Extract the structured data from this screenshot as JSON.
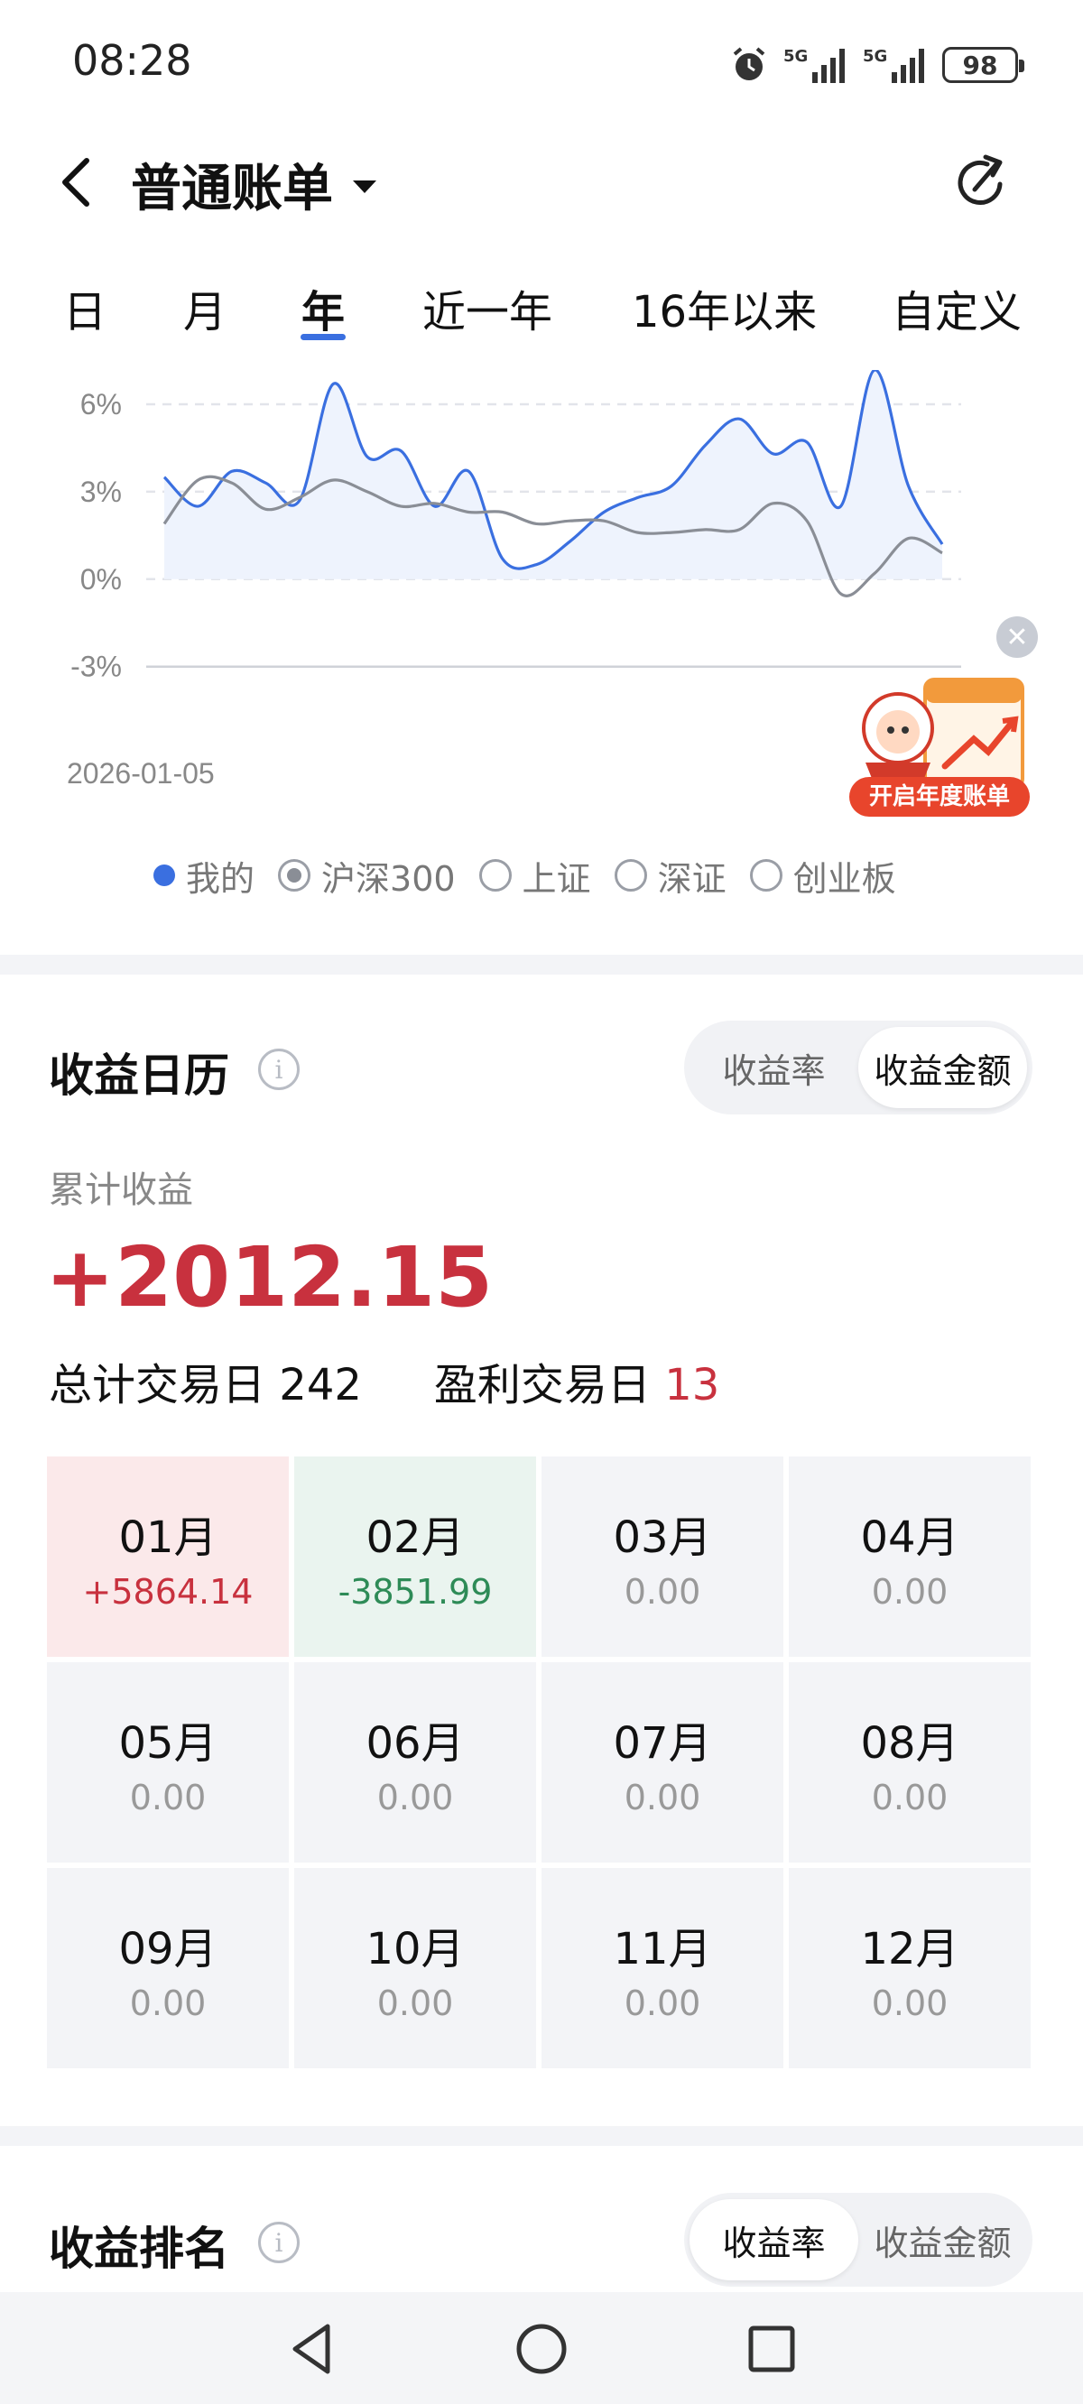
{
  "status_bar": {
    "time": "08:28",
    "battery": "98",
    "signal1": "5G",
    "signal2": "5G"
  },
  "header": {
    "title": "普通账单"
  },
  "tabs": [
    {
      "label": "日"
    },
    {
      "label": "月"
    },
    {
      "label": "年"
    },
    {
      "label": "近一年"
    },
    {
      "label": "16年以来"
    },
    {
      "label": "自定义"
    }
  ],
  "chart_data": {
    "type": "line",
    "y_ticks": [
      "6%",
      "3%",
      "0%",
      "-3%"
    ],
    "ylim": [
      -3,
      6.5
    ],
    "x_start_label": "2026-01-05",
    "grid": true,
    "series": [
      {
        "name": "我的",
        "color": "#3a6fe0",
        "values": [
          3.5,
          2.5,
          3.7,
          3.3,
          2.7,
          6.7,
          4.2,
          4.4,
          2.5,
          3.7,
          0.7,
          0.5,
          1.3,
          2.3,
          2.8,
          3.2,
          4.6,
          5.5,
          4.3,
          4.7,
          2.5,
          7.2,
          3.2,
          1.2
        ]
      },
      {
        "name": "沪深300",
        "color": "#8a8e96",
        "values": [
          1.9,
          3.4,
          3.3,
          2.4,
          2.8,
          3.4,
          3.0,
          2.5,
          2.6,
          2.3,
          2.3,
          1.9,
          2.0,
          2.0,
          1.6,
          1.6,
          1.7,
          1.7,
          2.6,
          2.0,
          -0.5,
          0.2,
          1.4,
          0.9
        ]
      }
    ]
  },
  "promo": {
    "label": "开启年度账单",
    "accent": "#e8452c"
  },
  "legend": [
    {
      "label": "我的",
      "kind": "dot"
    },
    {
      "label": "沪深300",
      "kind": "radio-on"
    },
    {
      "label": "上证",
      "kind": "radio"
    },
    {
      "label": "深证",
      "kind": "radio"
    },
    {
      "label": "创业板",
      "kind": "radio"
    }
  ],
  "calendar": {
    "title": "收益日历",
    "seg": [
      "收益率",
      "收益金额"
    ],
    "seg_active": 1,
    "cum_label": "累计收益",
    "cum_value": "+2012.15",
    "total_days_label": "总计交易日",
    "total_days": "242",
    "profit_days_label": "盈利交易日",
    "profit_days": "13",
    "months": [
      {
        "name": "01月",
        "value": "+5864.14",
        "state": "pos"
      },
      {
        "name": "02月",
        "value": "-3851.99",
        "state": "neg"
      },
      {
        "name": "03月",
        "value": "0.00",
        "state": "zero"
      },
      {
        "name": "04月",
        "value": "0.00",
        "state": "zero"
      },
      {
        "name": "05月",
        "value": "0.00",
        "state": "zero"
      },
      {
        "name": "06月",
        "value": "0.00",
        "state": "zero"
      },
      {
        "name": "07月",
        "value": "0.00",
        "state": "zero"
      },
      {
        "name": "08月",
        "value": "0.00",
        "state": "zero"
      },
      {
        "name": "09月",
        "value": "0.00",
        "state": "zero"
      },
      {
        "name": "10月",
        "value": "0.00",
        "state": "zero"
      },
      {
        "name": "11月",
        "value": "0.00",
        "state": "zero"
      },
      {
        "name": "12月",
        "value": "0.00",
        "state": "zero"
      }
    ]
  },
  "ranking": {
    "title": "收益排名",
    "seg": [
      "收益率",
      "收益金额"
    ],
    "seg_active": 0
  },
  "colors": {
    "accent": "#3a6fe0",
    "positive": "#c8313e",
    "negative": "#2e8b57"
  }
}
